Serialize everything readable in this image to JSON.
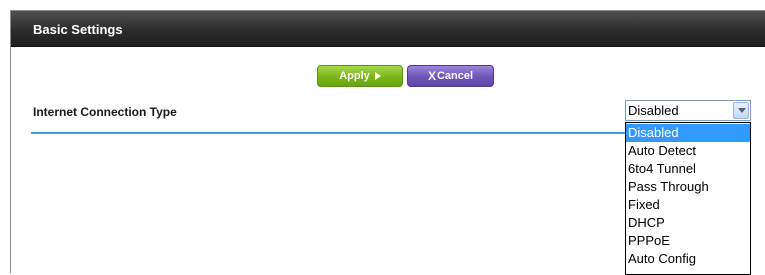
{
  "header": {
    "title": "Basic Settings"
  },
  "toolbar": {
    "apply_label": "Apply",
    "cancel_label": "Cancel",
    "cancel_prefix": "X"
  },
  "form": {
    "connection_type_label": "Internet Connection Type",
    "connection_type_value": "Disabled",
    "options": [
      "Disabled",
      "Auto Detect",
      "6to4 Tunnel",
      "Pass Through",
      "Fixed",
      "DHCP",
      "PPPoE",
      "Auto Config"
    ]
  },
  "colors": {
    "header_bg": "#2c2c2c",
    "apply_green": "#79b51a",
    "cancel_purple": "#6e55b8",
    "divider_blue": "#3b9fd8",
    "selection_blue": "#3399ff"
  },
  "icons": {
    "apply": "arrow-right-icon",
    "cancel": "x-icon",
    "select": "chevron-down-icon"
  }
}
